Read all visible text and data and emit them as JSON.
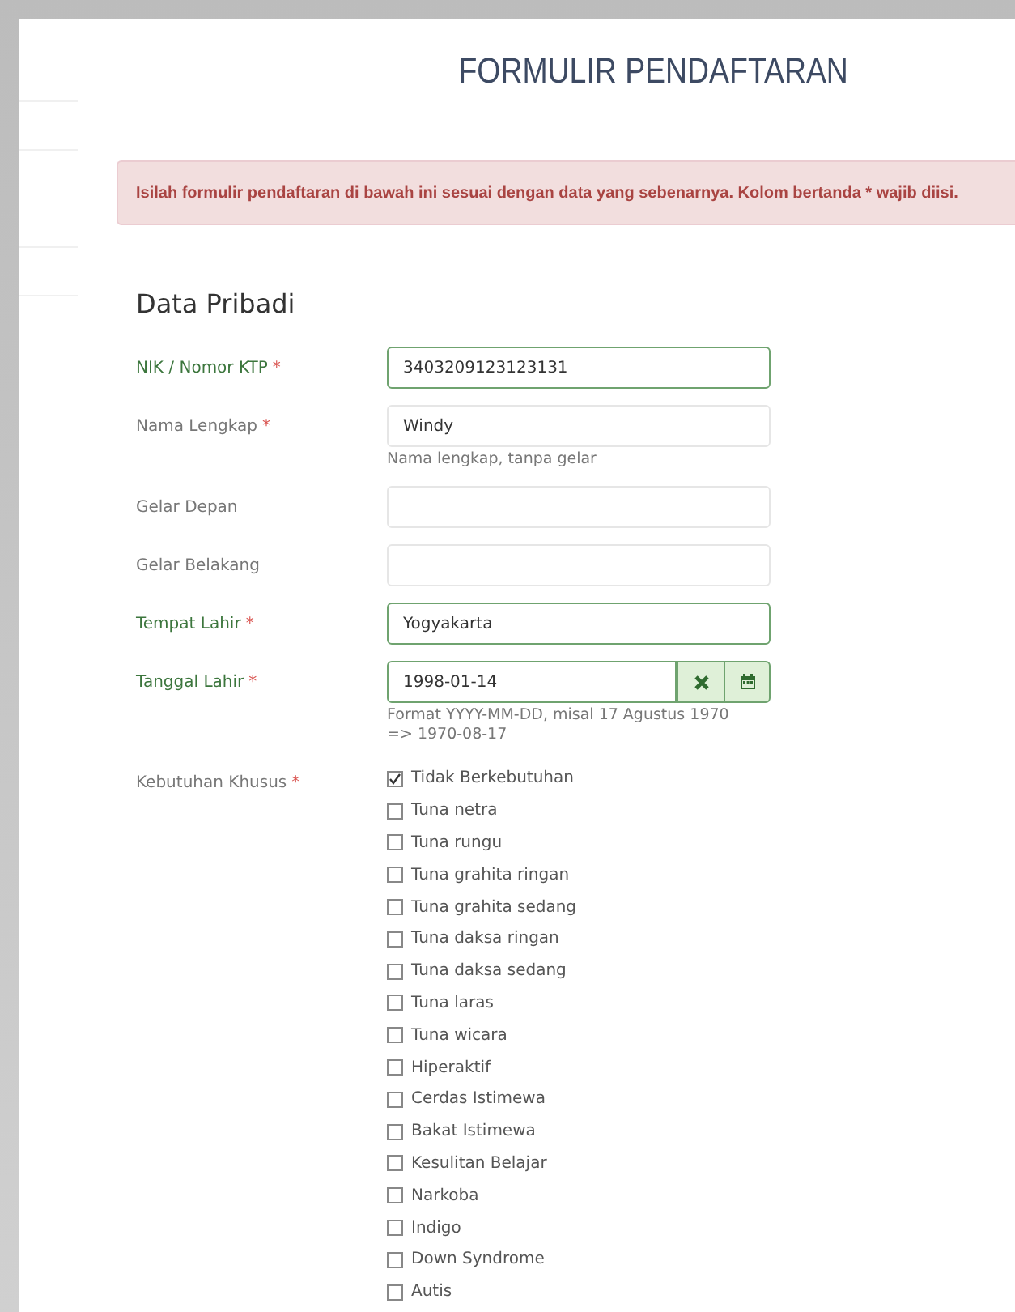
{
  "title": "FORMULIR PENDAFTARAN",
  "alert": "Isilah formulir pendaftaran di bawah ini sesuai dengan data yang sebenarnya. Kolom bertanda * wajib diisi.",
  "section": "Data Pribadi",
  "fields": [
    {
      "kind": "text",
      "label": "NIK / Nomor KTP",
      "required_mark": "*",
      "valid": true,
      "value": "3403209123123131"
    },
    {
      "kind": "text",
      "label": "Nama Lengkap",
      "required_mark": "*",
      "valid": false,
      "value": "Windy",
      "help": "Nama lengkap, tanpa gelar"
    },
    {
      "kind": "text",
      "label": "Gelar Depan",
      "valid": false
    },
    {
      "kind": "text",
      "label": "Gelar Belakang",
      "valid": false
    },
    {
      "kind": "text",
      "label": "Tempat Lahir",
      "required_mark": "*",
      "valid": true,
      "value": "Yogyakarta"
    },
    {
      "kind": "date",
      "label": "Tanggal Lahir",
      "required_mark": "*",
      "valid": true,
      "value": "1998-01-14",
      "help": "Format YYYY-MM-DD, misal 17 Agustus 1970 => 1970-08-17"
    },
    {
      "kind": "checklist",
      "label": "Kebutuhan Khusus",
      "required_mark": "*",
      "valid": false,
      "options": [
        {
          "label": "Tidak Berkebutuhan",
          "checked": true
        },
        {
          "label": "Tuna netra",
          "checked": false
        },
        {
          "label": "Tuna rungu",
          "checked": false
        },
        {
          "label": "Tuna grahita ringan",
          "checked": false
        },
        {
          "label": "Tuna grahita sedang",
          "checked": false
        },
        {
          "label": "Tuna daksa ringan",
          "checked": false
        },
        {
          "label": "Tuna daksa sedang",
          "checked": false
        },
        {
          "label": "Tuna laras",
          "checked": false
        },
        {
          "label": "Tuna wicara",
          "checked": false
        },
        {
          "label": "Hiperaktif",
          "checked": false
        },
        {
          "label": "Cerdas Istimewa",
          "checked": false
        },
        {
          "label": "Bakat Istimewa",
          "checked": false
        },
        {
          "label": "Kesulitan Belajar",
          "checked": false
        },
        {
          "label": "Narkoba",
          "checked": false
        },
        {
          "label": "Indigo",
          "checked": false
        },
        {
          "label": "Down Syndrome",
          "checked": false
        },
        {
          "label": "Autis",
          "checked": false
        }
      ]
    }
  ]
}
